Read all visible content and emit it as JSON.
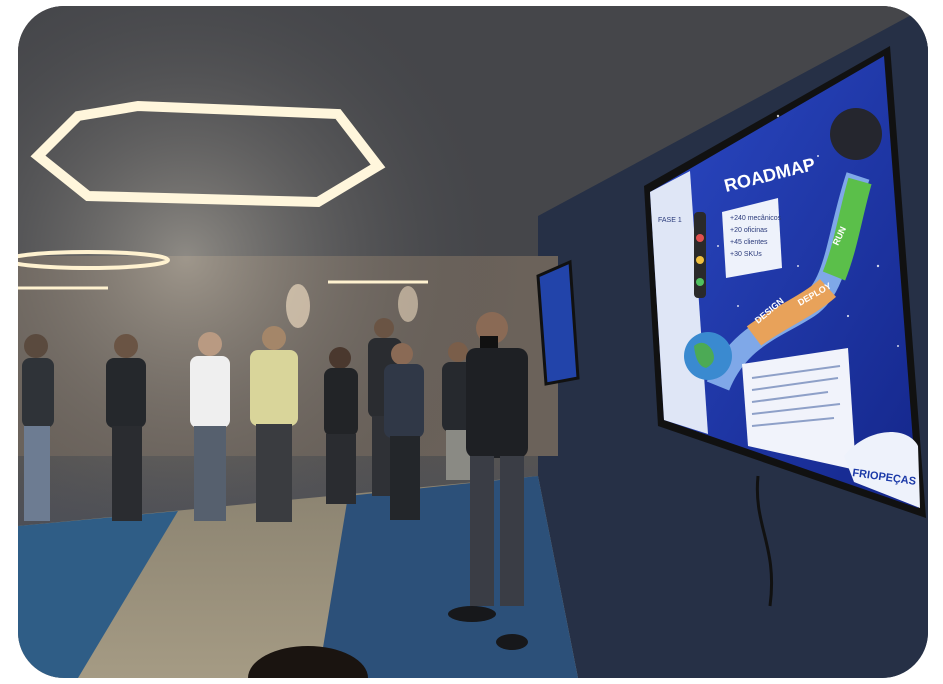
{
  "photo": {
    "description_tags": [
      "presentation",
      "roadmap",
      "audience"
    ]
  },
  "screen": {
    "title": "ROADMAP",
    "stats": [
      "+240 mecânicos",
      "+20 oficinas",
      "+45 clientes",
      "+30 SKUs"
    ],
    "stages": [
      "DESIGN",
      "DEPLOY",
      "RUN"
    ],
    "left_panel_title": "FASE 1",
    "brand": "FRIOPEÇAS"
  },
  "colors": {
    "screen_bg": "#1c3aa8",
    "road_orange": "#e8a25a",
    "road_green": "#5bbf4a",
    "road_blue": "#7fa8e8",
    "lamp": "#fff6dc"
  }
}
